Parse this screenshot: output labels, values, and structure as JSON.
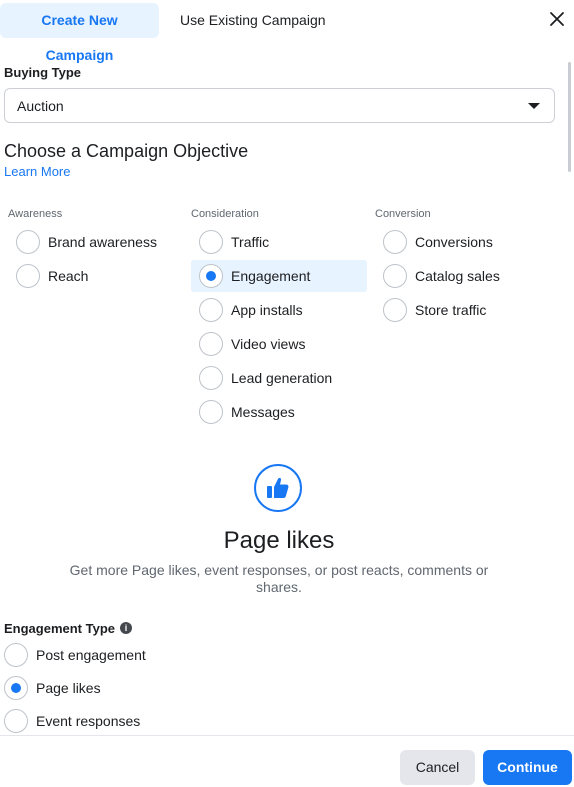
{
  "tabs": {
    "create": "Create New Campaign",
    "existing": "Use Existing Campaign"
  },
  "buying_type": {
    "label": "Buying Type",
    "value": "Auction"
  },
  "objective": {
    "heading": "Choose a Campaign Objective",
    "learn_more": "Learn More",
    "awareness": {
      "title": "Awareness",
      "options": [
        "Brand awareness",
        "Reach"
      ]
    },
    "consideration": {
      "title": "Consideration",
      "options": [
        "Traffic",
        "Engagement",
        "App installs",
        "Video views",
        "Lead generation",
        "Messages"
      ]
    },
    "conversion": {
      "title": "Conversion",
      "options": [
        "Conversions",
        "Catalog sales",
        "Store traffic"
      ]
    },
    "selected": "Engagement"
  },
  "detail": {
    "icon": "thumbs-up-icon",
    "title": "Page likes",
    "description": "Get more Page likes, event responses, or post reacts, comments or shares."
  },
  "engagement_type": {
    "label": "Engagement Type",
    "options": [
      "Post engagement",
      "Page likes",
      "Event responses"
    ],
    "selected": "Page likes"
  },
  "footer": {
    "cancel": "Cancel",
    "continue": "Continue"
  },
  "colors": {
    "accent": "#1877f2",
    "selected_bg": "#e7f3ff"
  }
}
